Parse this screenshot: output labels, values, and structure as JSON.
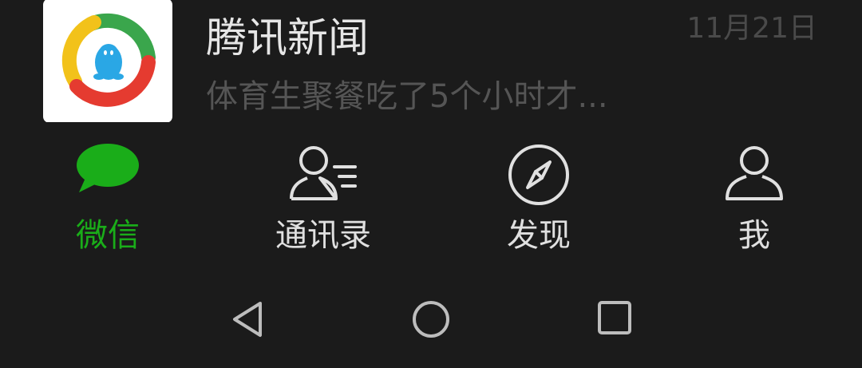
{
  "chat": {
    "title": "腾讯新闻",
    "preview": "体育生聚餐吃了5个小时才...",
    "time": "11月21日",
    "avatar_icon": "tencent-news-logo"
  },
  "tabs": [
    {
      "label": "微信",
      "icon": "chat-bubble-icon",
      "active": true
    },
    {
      "label": "通讯录",
      "icon": "contacts-icon",
      "active": false
    },
    {
      "label": "发现",
      "icon": "compass-icon",
      "active": false
    },
    {
      "label": "我",
      "icon": "person-icon",
      "active": false
    }
  ],
  "navbar": {
    "buttons": [
      "back-icon",
      "home-icon",
      "recents-icon"
    ]
  },
  "colors": {
    "background": "#1b1b1b",
    "active_tab": "#1aad19",
    "tab_text": "#e0e0e0",
    "title_text": "#e6e6e6",
    "preview_text": "#555555"
  }
}
